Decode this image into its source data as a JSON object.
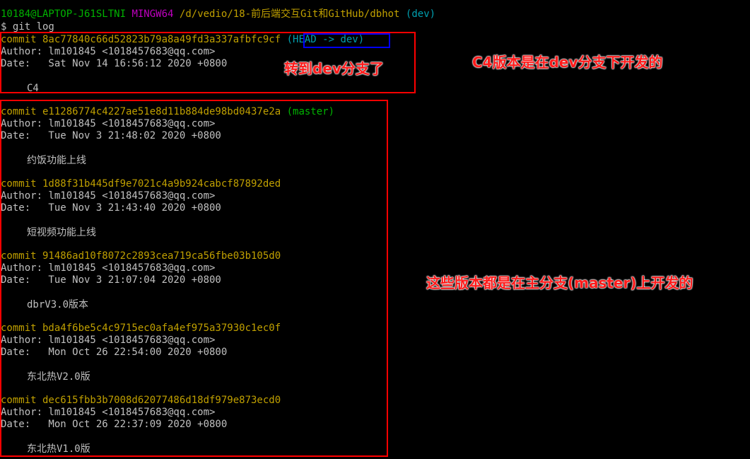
{
  "prompt": {
    "user_host": "10184@LAPTOP-J61SLTNI",
    "env": "MINGW64",
    "path": "/d/vedio/18-前后端交互Git和GitHub/dbhot",
    "branch": "(dev)"
  },
  "command": "$ git log",
  "commits": [
    {
      "commit_line": "commit 8ac77840c66d52823b79a8a49fd3a337afbfc9cf",
      "ref": "(HEAD -> dev)",
      "author": "Author: lm101845 <1018457683@qq.com>",
      "date": "Date:   Sat Nov 14 16:56:12 2020 +0800",
      "message": "C4"
    },
    {
      "commit_line": "commit e11286774c4227ae51e8d11b884de98bd0437e2a",
      "ref": "(master)",
      "author": "Author: lm101845 <1018457683@qq.com>",
      "date": "Date:   Tue Nov 3 21:48:02 2020 +0800",
      "message": "约饭功能上线"
    },
    {
      "commit_line": "commit 1d88f31b445df9e7021c4a9b924cabcf87892ded",
      "ref": "",
      "author": "Author: lm101845 <1018457683@qq.com>",
      "date": "Date:   Tue Nov 3 21:43:40 2020 +0800",
      "message": "短视频功能上线"
    },
    {
      "commit_line": "commit 91486ad10f8072c2893cea719ca56fbe03b105d0",
      "ref": "",
      "author": "Author: lm101845 <1018457683@qq.com>",
      "date": "Date:   Tue Nov 3 21:07:04 2020 +0800",
      "message": "dbrV3.0版本"
    },
    {
      "commit_line": "commit bda4f6be5c4c9715ec0afa4ef975a37930c1ec0f",
      "ref": "",
      "author": "Author: lm101845 <1018457683@qq.com>",
      "date": "Date:   Mon Oct 26 22:54:00 2020 +0800",
      "message": "东北热V2.0版"
    },
    {
      "commit_line": "commit dec615fbb3b7008d62077486d18df979e873ecd0",
      "ref": "",
      "author": "Author: lm101845 <1018457683@qq.com>",
      "date": "Date:   Mon Oct 26 22:37:09 2020 +0800",
      "message": "东北热V1.0版"
    }
  ],
  "annotations": {
    "switched": "转到dev分支了",
    "c4_dev": "C4版本是在dev分支下开发的",
    "master": "这些版本都是在主分支(master)上开发的"
  },
  "colors": {
    "background": "#000000",
    "prompt_green": "#00b300",
    "env_magenta": "#c000c0",
    "hash_yellow": "#c0a000",
    "branch_cyan": "#00a0b0",
    "annotation_red": "#ff1a1a"
  }
}
